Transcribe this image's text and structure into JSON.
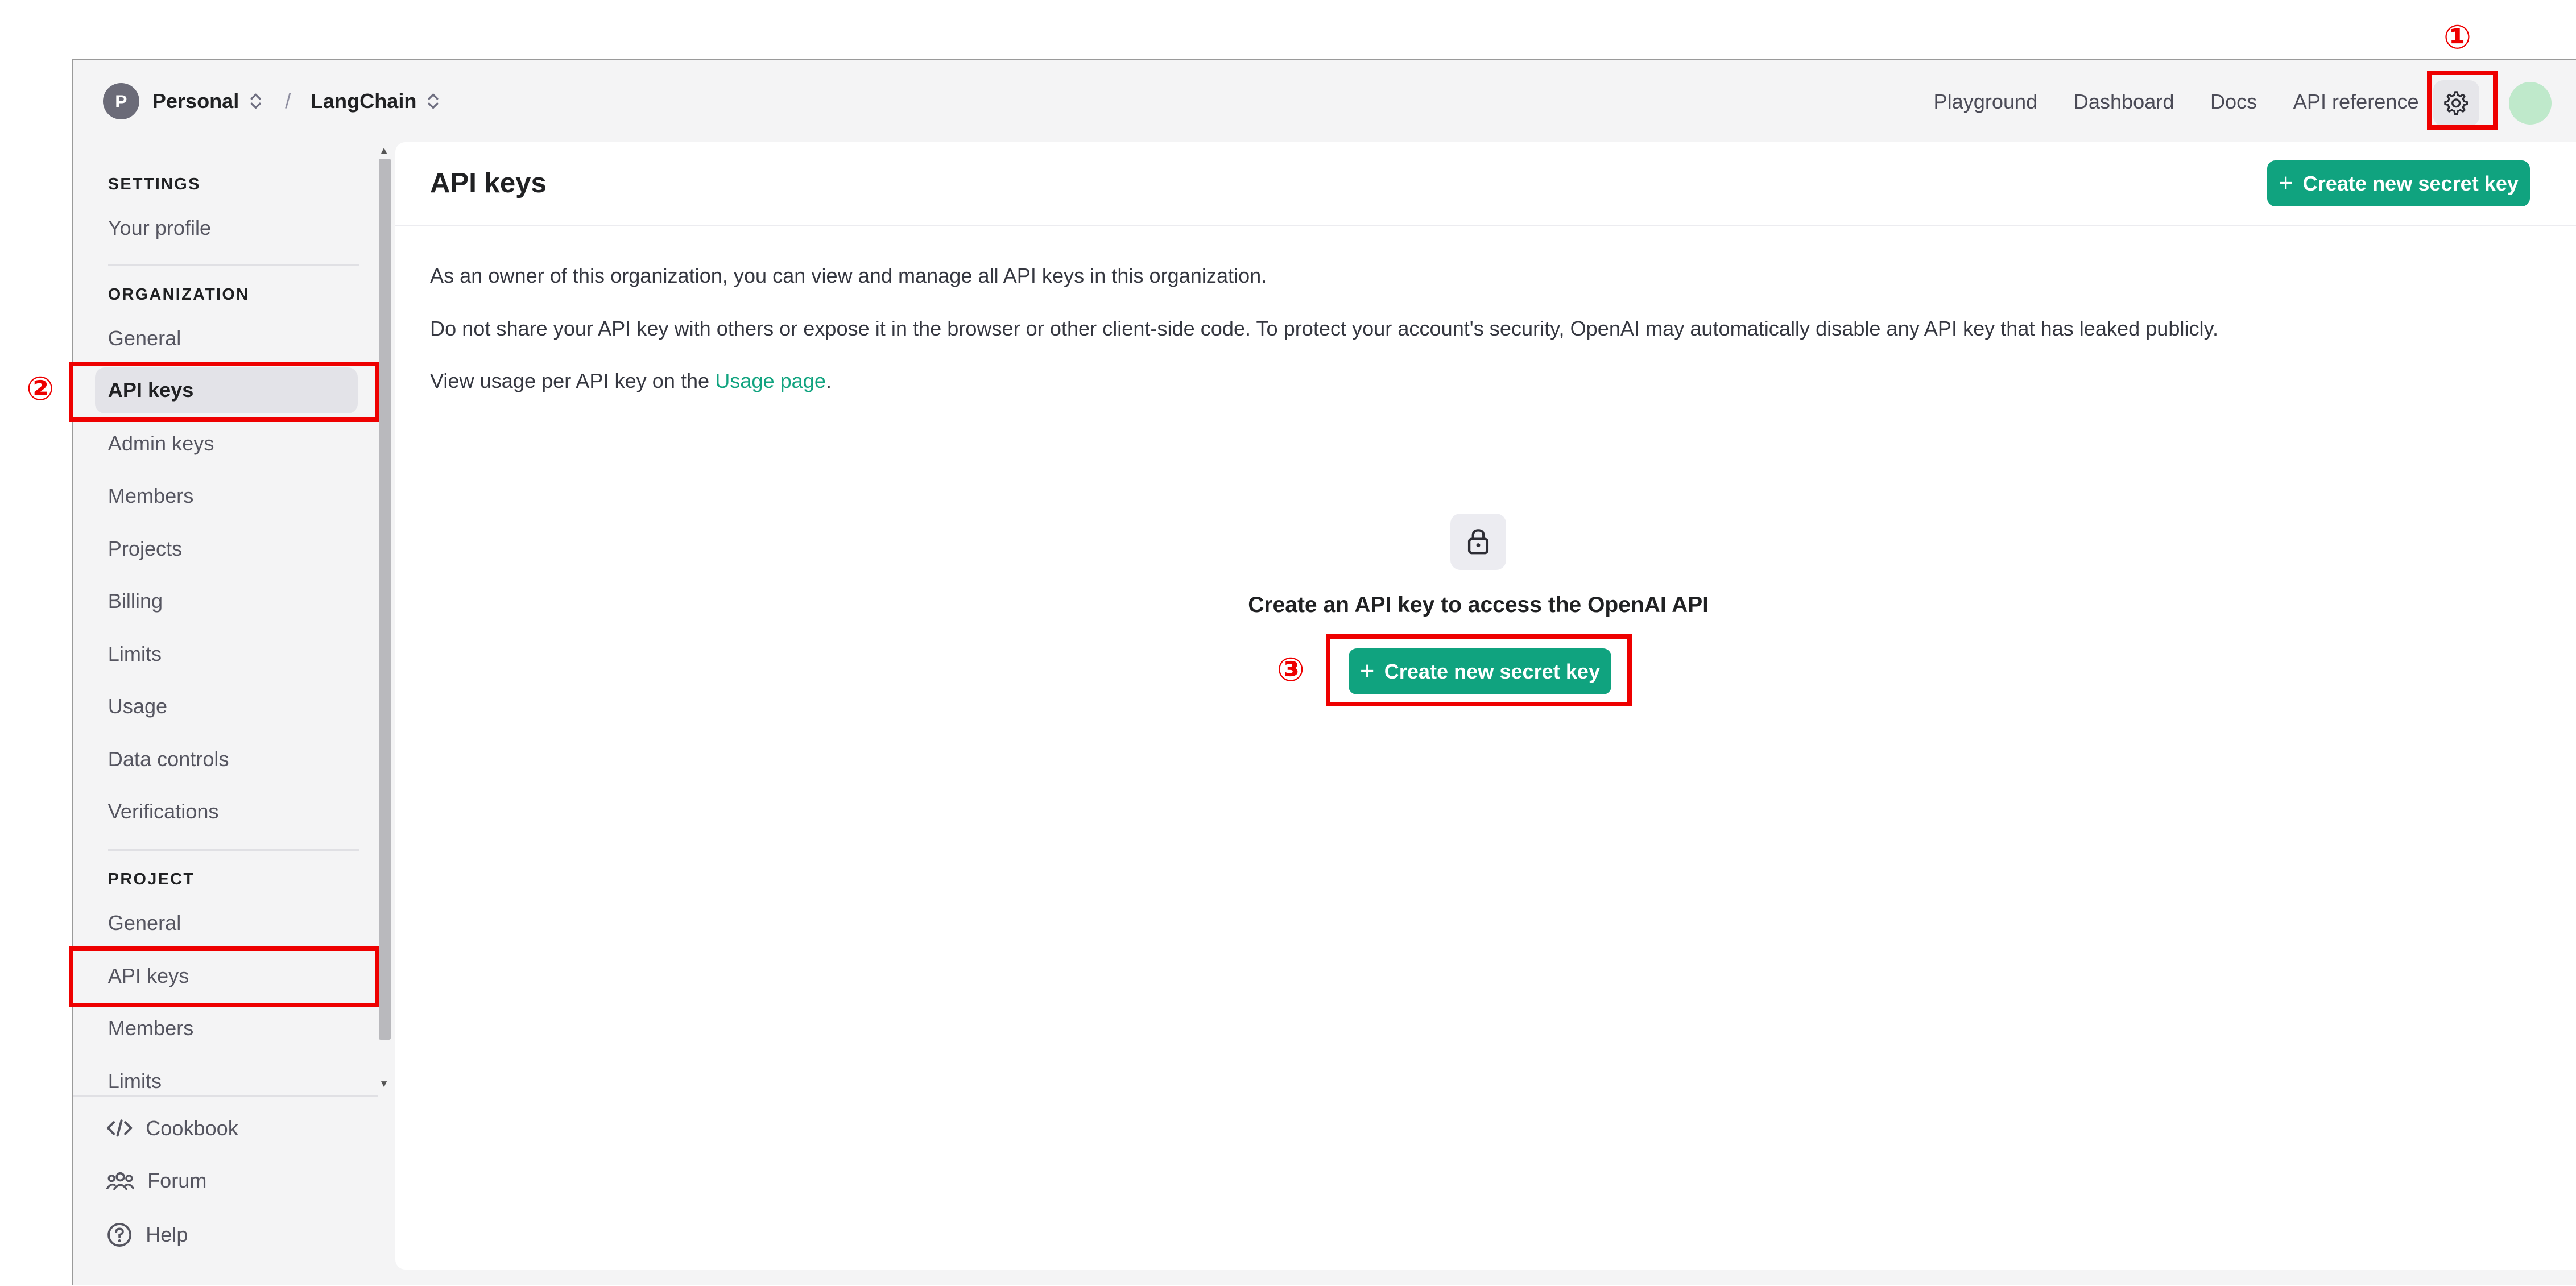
{
  "topbar": {
    "org_initial": "P",
    "org_name": "Personal",
    "separator": "/",
    "project_name": "LangChain",
    "nav": [
      "Playground",
      "Dashboard",
      "Docs",
      "API reference"
    ],
    "settings_icon": "gear-icon"
  },
  "sidebar": {
    "settings_header": "SETTINGS",
    "your_profile": "Your profile",
    "org_header": "ORGANIZATION",
    "org_items": [
      "General",
      "API keys",
      "Admin keys",
      "Members",
      "Projects",
      "Billing",
      "Limits",
      "Usage",
      "Data controls",
      "Verifications"
    ],
    "project_header": "PROJECT",
    "project_items": [
      "General",
      "API keys",
      "Members",
      "Limits"
    ],
    "bottom": [
      {
        "label": "Cookbook",
        "icon": "code-icon"
      },
      {
        "label": "Forum",
        "icon": "users-icon"
      },
      {
        "label": "Help",
        "icon": "help-icon"
      }
    ]
  },
  "main": {
    "title": "API keys",
    "create_button": "Create new secret key",
    "para1": "As an owner of this organization, you can view and manage all API keys in this organization.",
    "para2": "Do not share your API key with others or expose it in the browser or other client-side code. To protect your account's security, OpenAI may automatically disable any API key that has leaked publicly.",
    "para3_prefix": "View usage per API key on the ",
    "para3_link": "Usage page",
    "para3_suffix": ".",
    "empty_icon": "lock-icon",
    "empty_title": "Create an API key to access the OpenAI API",
    "empty_button": "Create new secret key"
  },
  "annotations": {
    "markers": [
      "①",
      "②",
      "③"
    ],
    "color": "#ee0000"
  },
  "colors": {
    "accent": "#10a37f",
    "sidebar_bg": "#f4f4f5",
    "active_item_bg": "#e3e3e8",
    "user_avatar": "#bfe9cb"
  }
}
